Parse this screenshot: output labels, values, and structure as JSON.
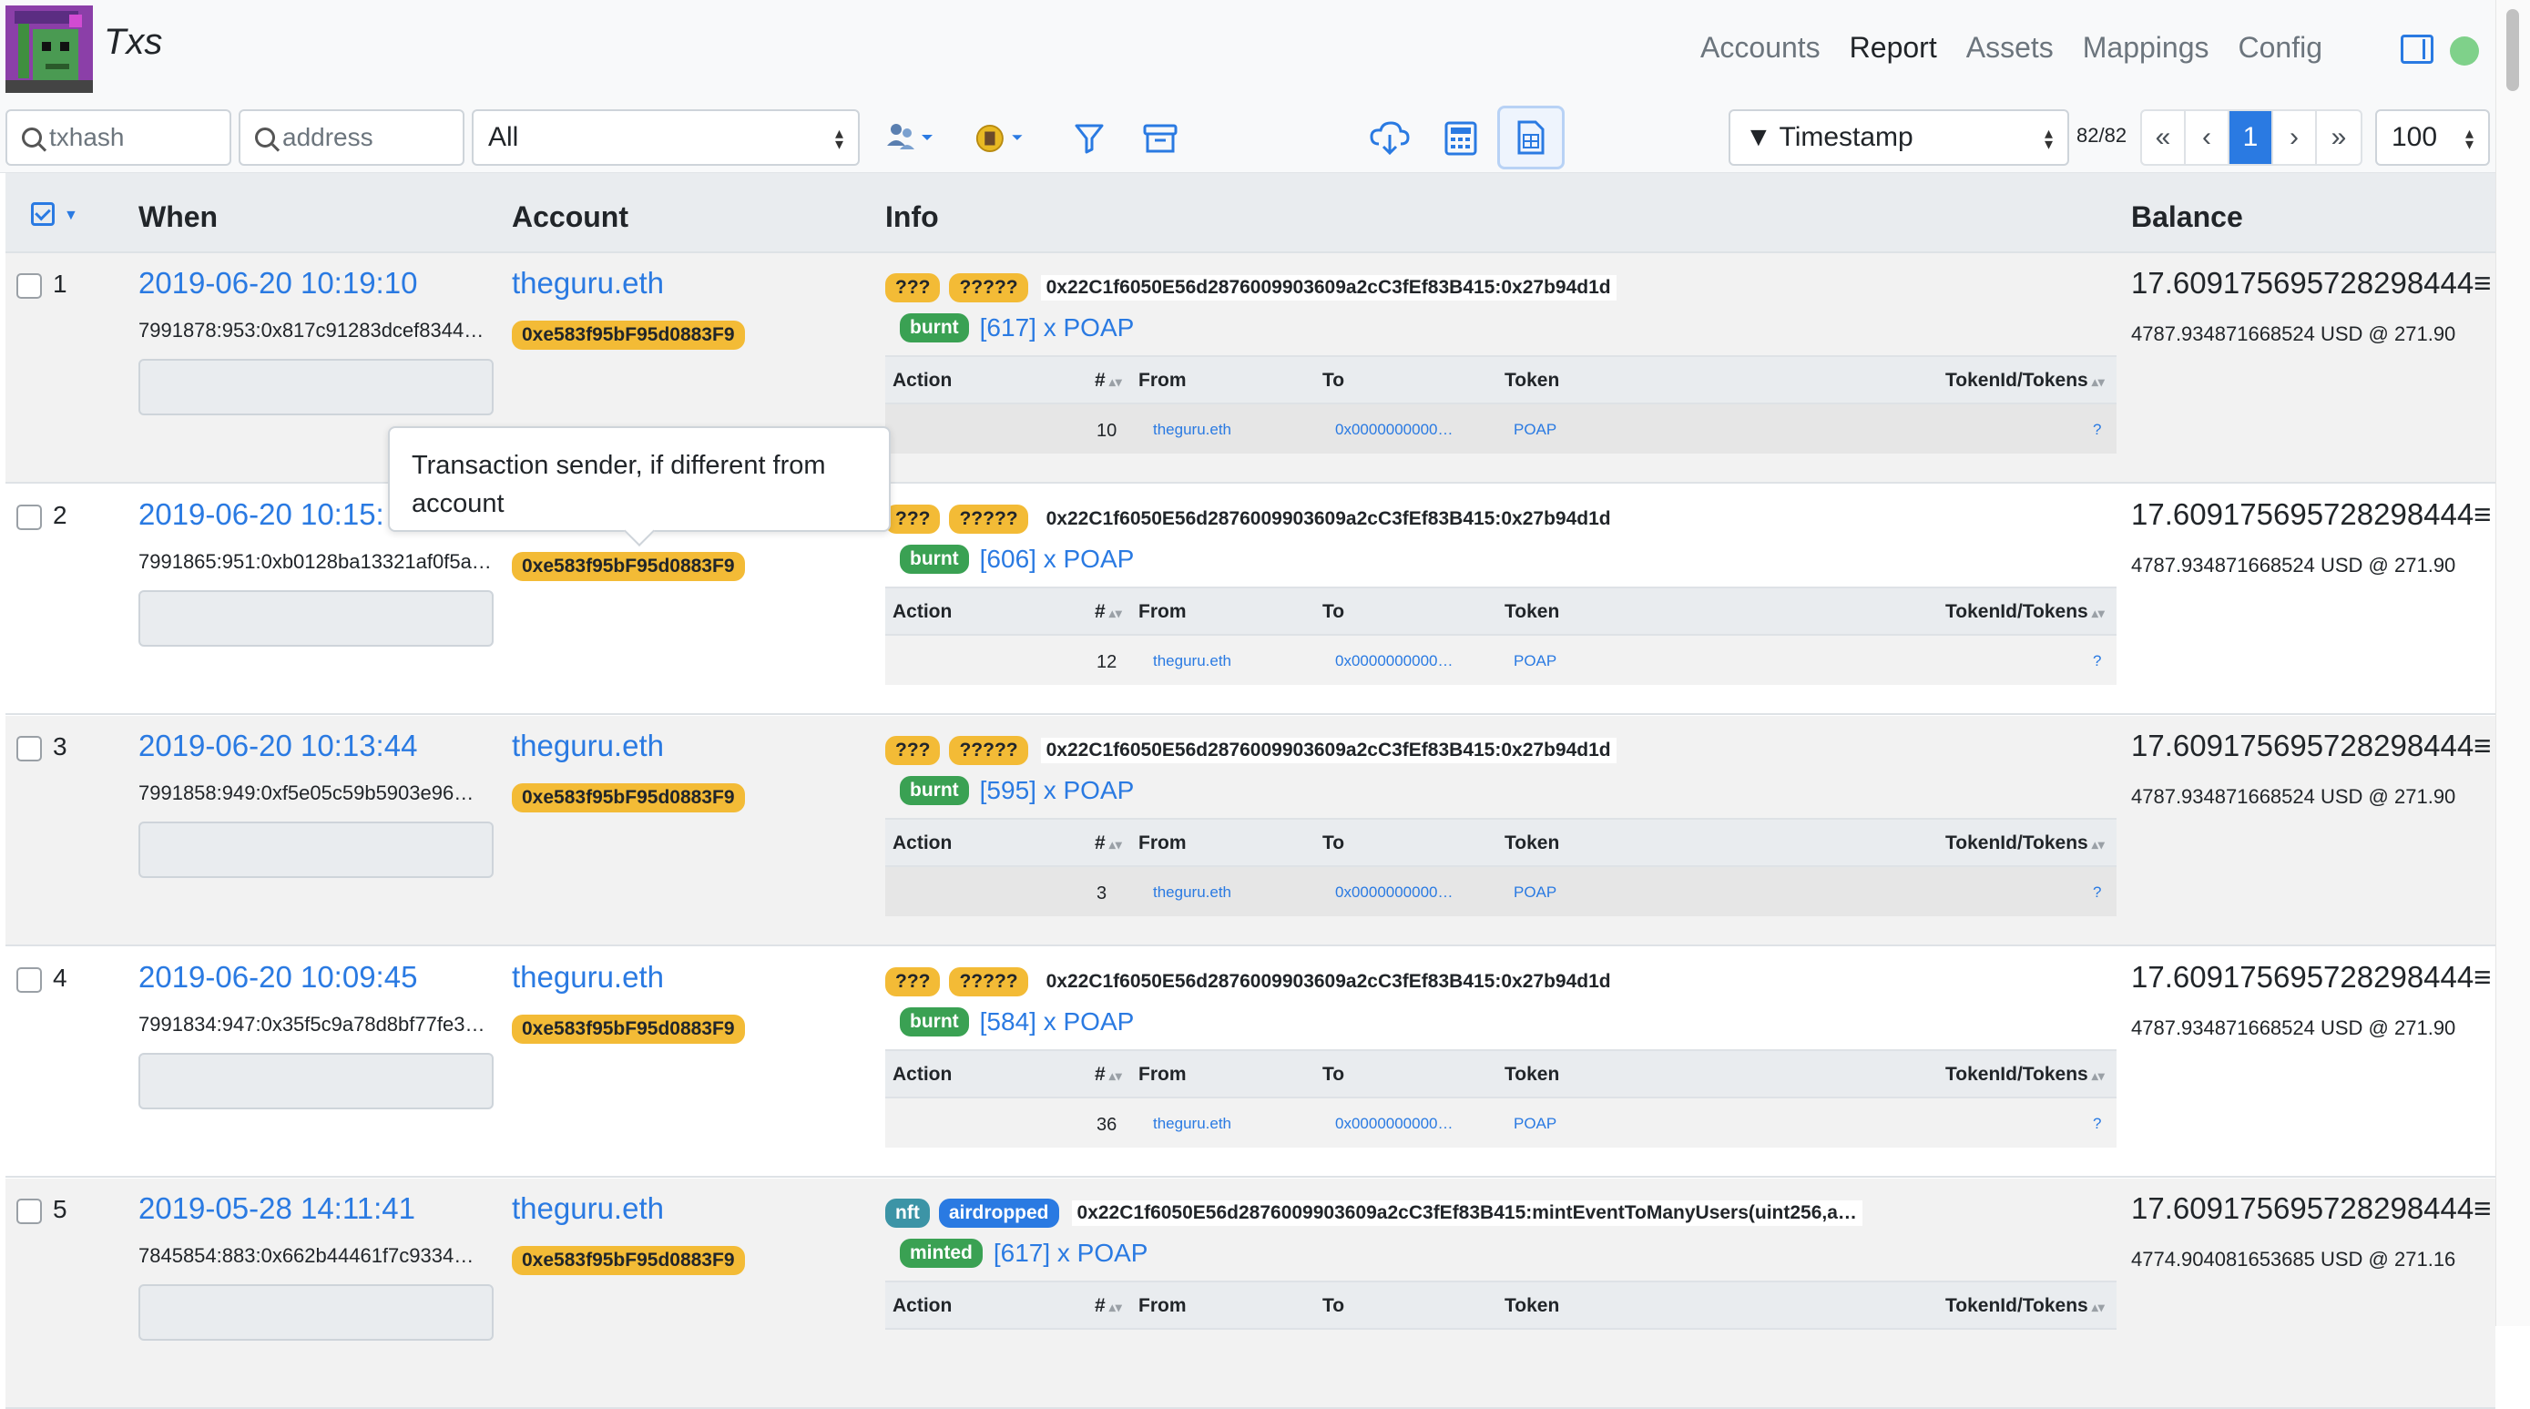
{
  "app": {
    "title": "Txs"
  },
  "nav": {
    "items": [
      "Accounts",
      "Report",
      "Assets",
      "Mappings",
      "Config"
    ],
    "active": "Report"
  },
  "toolbar": {
    "txhash_placeholder": "txhash",
    "address_placeholder": "address",
    "filter_select": "All",
    "sort_select": "▼ Timestamp",
    "page_count": "82/82",
    "pager": {
      "first": "«",
      "prev": "‹",
      "current": "1",
      "next": "›",
      "last": "»"
    },
    "page_size": "100"
  },
  "table": {
    "columns": {
      "when": "When",
      "account": "Account",
      "info": "Info",
      "balance": "Balance"
    },
    "sub_columns": {
      "action": "Action",
      "num": "#",
      "from": "From",
      "to": "To",
      "token": "Token",
      "tokenid": "TokenId/Tokens"
    },
    "rows": [
      {
        "index": "1",
        "when": "2019-06-20 10:19:10",
        "txid": "7991878:953:0x817c91283dcef8344…",
        "account": "theguru.eth",
        "sender": "0xe583f95bF95d0883F9",
        "tags": [
          "???",
          "?????"
        ],
        "method": "0x22C1f6050E56d2876009903609a2cC3fEf83B415:0x27b94d1d",
        "op": "burnt",
        "transfer": "[617] x POAP",
        "sub": {
          "num": "10",
          "from": "theguru.eth",
          "to": "0x0000000000…",
          "token": "POAP",
          "tokenid": "?"
        },
        "balance": "17.609175695728298444≡",
        "balance_usd": "4787.934871668524 USD @ 271.90"
      },
      {
        "index": "2",
        "when": "2019-06-20 10:15:",
        "txid": "7991865:951:0xb0128ba13321af0f5a…",
        "account": "",
        "sender": "0xe583f95bF95d0883F9",
        "tags": [
          "???",
          "?????"
        ],
        "method": "0x22C1f6050E56d2876009903609a2cC3fEf83B415:0x27b94d1d",
        "op": "burnt",
        "transfer": "[606] x POAP",
        "sub": {
          "num": "12",
          "from": "theguru.eth",
          "to": "0x0000000000…",
          "token": "POAP",
          "tokenid": "?"
        },
        "balance": "17.609175695728298444≡",
        "balance_usd": "4787.934871668524 USD @ 271.90"
      },
      {
        "index": "3",
        "when": "2019-06-20 10:13:44",
        "txid": "7991858:949:0xf5e05c59b5903e96…",
        "account": "theguru.eth",
        "sender": "0xe583f95bF95d0883F9",
        "tags": [
          "???",
          "?????"
        ],
        "method": "0x22C1f6050E56d2876009903609a2cC3fEf83B415:0x27b94d1d",
        "op": "burnt",
        "transfer": "[595] x POAP",
        "sub": {
          "num": "3",
          "from": "theguru.eth",
          "to": "0x0000000000…",
          "token": "POAP",
          "tokenid": "?"
        },
        "balance": "17.609175695728298444≡",
        "balance_usd": "4787.934871668524 USD @ 271.90"
      },
      {
        "index": "4",
        "when": "2019-06-20 10:09:45",
        "txid": "7991834:947:0x35f5c9a78d8bf77fe3…",
        "account": "theguru.eth",
        "sender": "0xe583f95bF95d0883F9",
        "tags": [
          "???",
          "?????"
        ],
        "method": "0x22C1f6050E56d2876009903609a2cC3fEf83B415:0x27b94d1d",
        "op": "burnt",
        "transfer": "[584] x POAP",
        "sub": {
          "num": "36",
          "from": "theguru.eth",
          "to": "0x0000000000…",
          "token": "POAP",
          "tokenid": "?"
        },
        "balance": "17.609175695728298444≡",
        "balance_usd": "4787.934871668524 USD @ 271.90"
      },
      {
        "index": "5",
        "when": "2019-05-28 14:11:41",
        "txid": "7845854:883:0x662b44461f7c9334…",
        "account": "theguru.eth",
        "sender": "0xe583f95bF95d0883F9",
        "tags": [
          "nft",
          "airdropped"
        ],
        "method": "0x22C1f6050E56d2876009903609a2cC3fEf83B415:mintEventToManyUsers(uint256,a…",
        "op": "minted",
        "transfer": "[617] x POAP",
        "balance": "17.609175695728298444≡",
        "balance_usd": "4774.904081653685 USD @ 271.16"
      }
    ]
  },
  "tooltip": {
    "text": "Transaction sender, if different from account"
  },
  "colors": {
    "accent": "#2a7ae2",
    "warning": "#f3bb36",
    "success": "#3aa153",
    "info": "#3c94a6",
    "status_dot": "#7fd18a"
  },
  "icons": [
    "sidebar-toggle-icon",
    "search-icon",
    "users-filter-icon",
    "coin-filter-icon",
    "funnel-icon",
    "archive-icon",
    "cloud-download-icon",
    "calculator-icon",
    "spreadsheet-icon"
  ]
}
